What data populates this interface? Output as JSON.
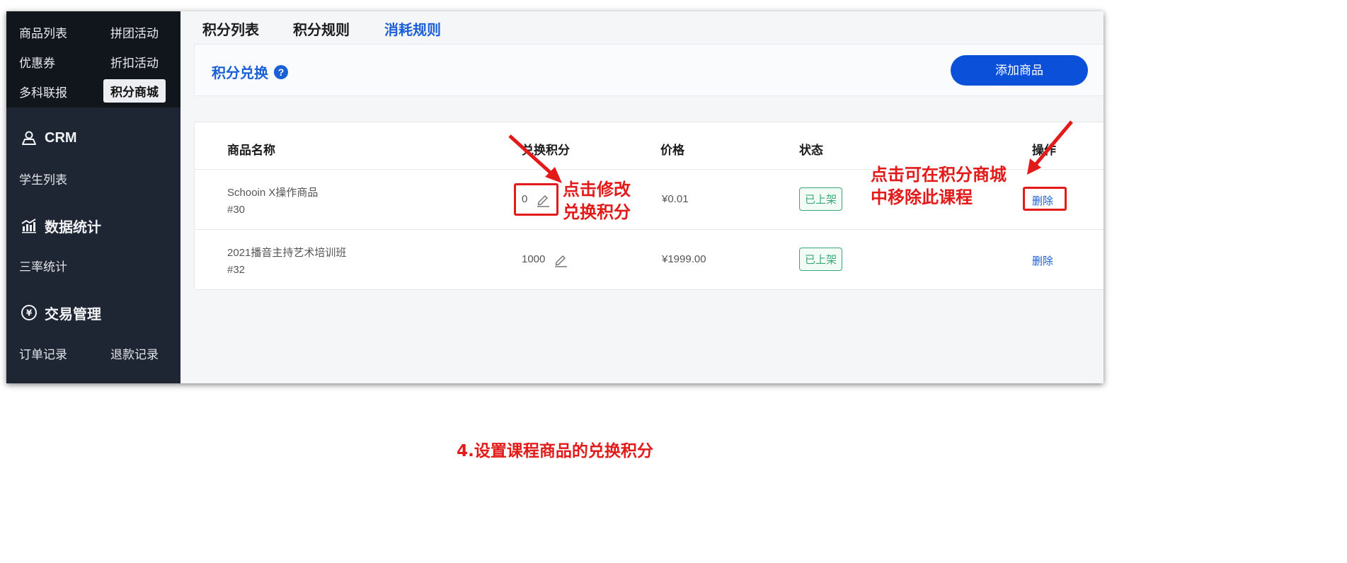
{
  "sidebar": {
    "top_rows": [
      {
        "left": "商品列表",
        "right": "拼团活动"
      },
      {
        "left": "优惠券",
        "right": "折扣活动"
      },
      {
        "left": "多科联报",
        "right": "积分商城"
      }
    ],
    "crm": {
      "title": "CRM",
      "items": [
        "学生列表"
      ]
    },
    "stats": {
      "title": "数据统计",
      "items": [
        "三率统计"
      ]
    },
    "trade": {
      "title": "交易管理",
      "items": [
        "订单记录",
        "退款记录"
      ]
    }
  },
  "tabs": [
    "积分列表",
    "积分规则",
    "消耗规则"
  ],
  "panel": {
    "title": "积分兑换",
    "help_glyph": "?",
    "add_button": "添加商品"
  },
  "table": {
    "headers": [
      "商品名称",
      "兑换积分",
      "价格",
      "状态",
      "操作"
    ],
    "rows": [
      {
        "name": "Schooin X操作商品",
        "id": "#30",
        "points": "0",
        "price": "¥0.01",
        "status": "已上架",
        "action": "删除"
      },
      {
        "name": "2021播音主持艺术培训班",
        "id": "#32",
        "points": "1000",
        "price": "¥1999.00",
        "status": "已上架",
        "action": "删除"
      }
    ]
  },
  "annotations": {
    "edit_points": [
      "点击修改",
      "兑换积分"
    ],
    "remove_course": [
      "点击可在积分商城",
      "中移除此课程"
    ],
    "caption": "4.设置课程商品的兑换积分",
    "color": "#e31a1a"
  }
}
